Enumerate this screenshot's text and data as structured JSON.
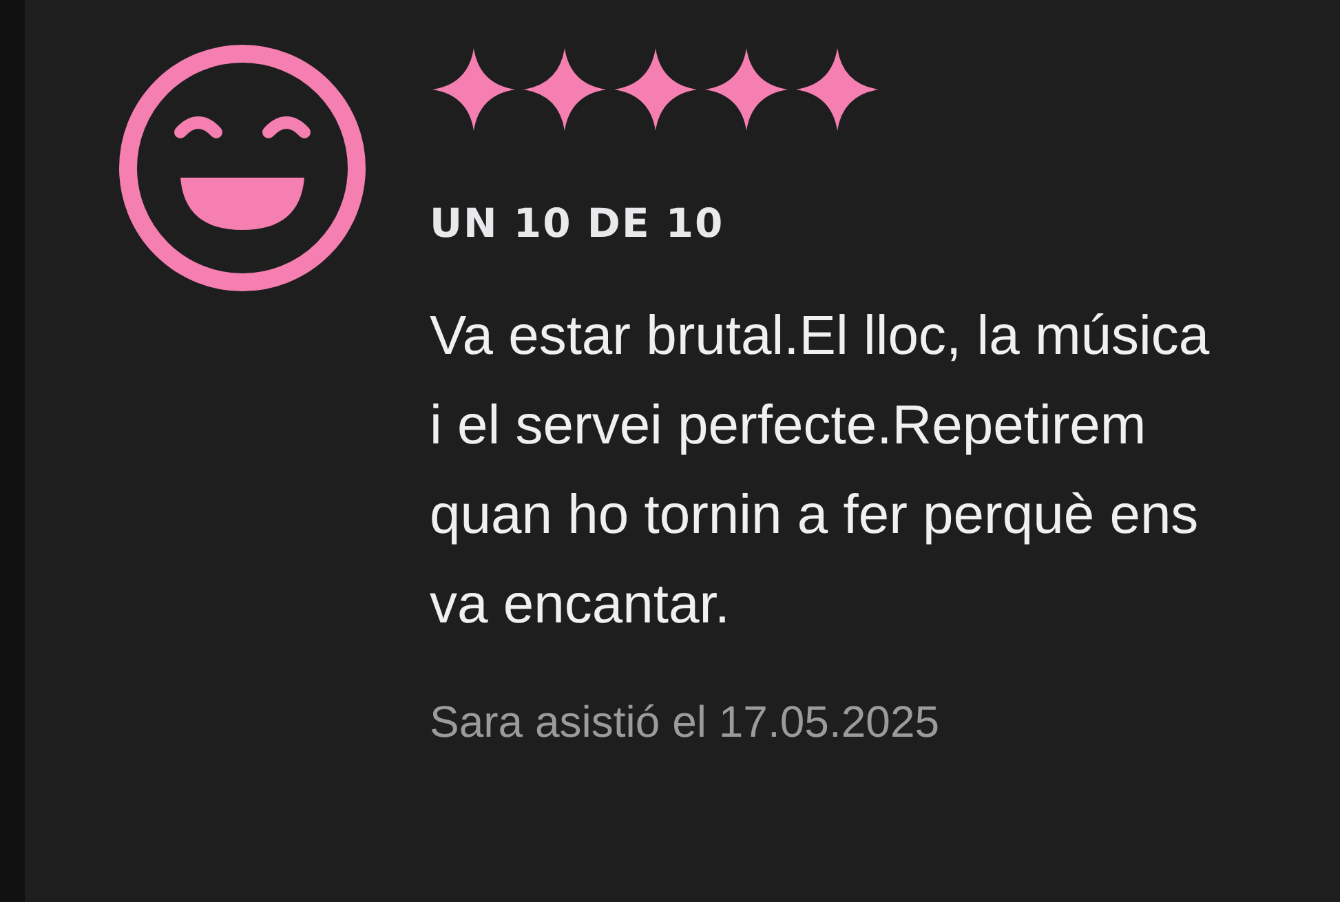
{
  "review": {
    "stars": 5,
    "title": "UN 10 DE 10",
    "text": "Va estar brutal.El lloc, la música i el servei perfecte.Repetirem quan ho tornin a fer perquè ens va encantar.",
    "attendance": "Sara asistió el 17.05.2025"
  }
}
